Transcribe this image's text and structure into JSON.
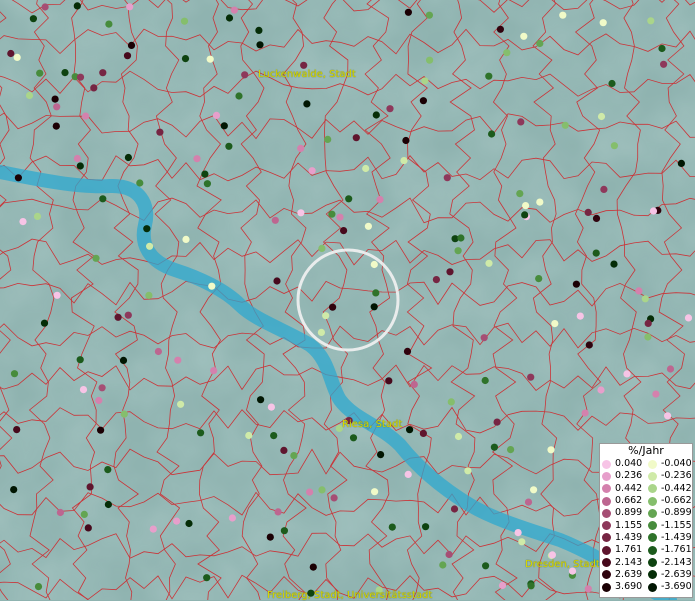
{
  "map": {
    "cities": [
      {
        "key": "luckenwalde",
        "label": "Luckenwalde, Stadt"
      },
      {
        "key": "riesa",
        "label": "Riesa, Stadt"
      },
      {
        "key": "dresden",
        "label": "Dresden, Stadt"
      },
      {
        "key": "freiberg",
        "label": "Freiberg, Stadt, Universitätsstadt"
      }
    ]
  },
  "legend": {
    "title": "%/Jahr",
    "positive": [
      {
        "label": "0.040",
        "color": "#f7c4e6"
      },
      {
        "label": "0.236",
        "color": "#e79fcb"
      },
      {
        "label": "0.442",
        "color": "#d481ad"
      },
      {
        "label": "0.662",
        "color": "#bd6690"
      },
      {
        "label": "0.899",
        "color": "#a64e74"
      },
      {
        "label": "1.155",
        "color": "#8e385b"
      },
      {
        "label": "1.439",
        "color": "#762543"
      },
      {
        "label": "1.761",
        "color": "#5f152e"
      },
      {
        "label": "2.143",
        "color": "#47091c"
      },
      {
        "label": "2.639",
        "color": "#30030e"
      },
      {
        "label": "3.690",
        "color": "#1b0004"
      }
    ],
    "negative": [
      {
        "label": "-0.040",
        "color": "#f1fac8"
      },
      {
        "label": "-0.236",
        "color": "#cfeaa8"
      },
      {
        "label": "-0.442",
        "color": "#aad58a"
      },
      {
        "label": "-0.662",
        "color": "#85be6c"
      },
      {
        "label": "-0.899",
        "color": "#64a552"
      },
      {
        "label": "-1.155",
        "color": "#478c3c"
      },
      {
        "label": "-1.439",
        "color": "#2f732a"
      },
      {
        "label": "-1.761",
        "color": "#1c5b1c"
      },
      {
        "label": "-2.143",
        "color": "#0e4310"
      },
      {
        "label": "-2.639",
        "color": "#052d07"
      },
      {
        "label": "-3.690",
        "color": "#011602"
      }
    ]
  },
  "colors": {
    "boundary": "#d0252a",
    "river": "#2ea8cf",
    "background": "#8fb3b0",
    "city_label": "#d8d800"
  }
}
